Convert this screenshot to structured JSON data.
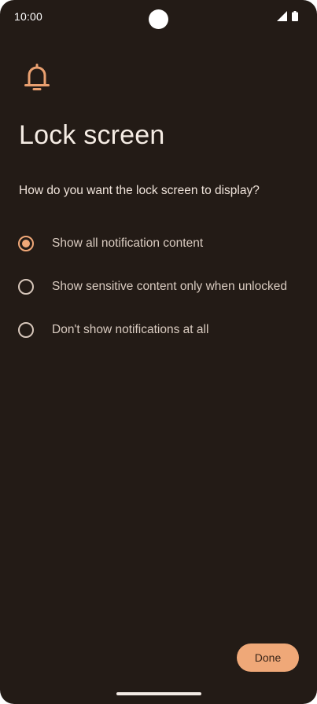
{
  "status_bar": {
    "time": "10:00",
    "icons": [
      "signal-icon",
      "battery-icon"
    ]
  },
  "header": {
    "icon": "bell-icon",
    "title": "Lock screen"
  },
  "question": "How do you want the lock screen to display?",
  "options": [
    {
      "label": "Show all notification content",
      "selected": true
    },
    {
      "label": "Show sensitive content only when unlocked",
      "selected": false
    },
    {
      "label": "Don't show notifications at all",
      "selected": false
    }
  ],
  "done_label": "Done",
  "colors": {
    "background": "#231b16",
    "accent": "#f0a878",
    "button": "#efa878"
  }
}
